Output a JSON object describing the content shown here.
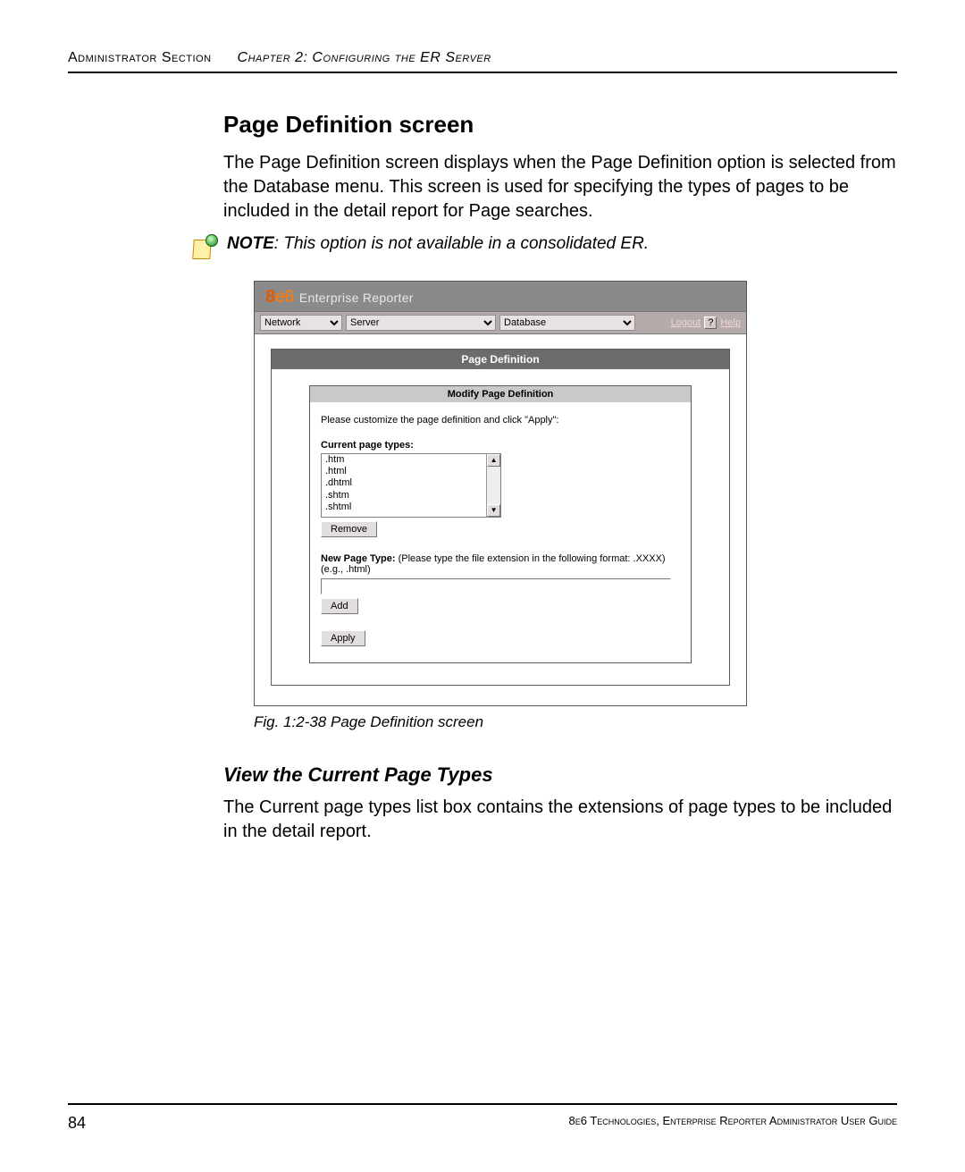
{
  "header": {
    "section": "Administrator Section",
    "chapter": "Chapter 2: Configuring the ER Server"
  },
  "section_title": "Page Definition screen",
  "intro_para": "The Page Definition screen displays when the Page Definition option is selected from the Database menu. This screen is used for specifying the types of pages to be included in the detail report for Page searches.",
  "note": {
    "label": "NOTE",
    "text": ": This option is not available in a consolidated ER."
  },
  "app": {
    "brand_8": "8",
    "brand_e6": "e6",
    "product": "Enterprise Reporter",
    "menus": {
      "network": "Network",
      "server": "Server",
      "database": "Database"
    },
    "logout": "Logout",
    "help_q": "?",
    "help": "Help",
    "panel_title": "Page Definition",
    "subpanel_title": "Modify Page Definition",
    "instruction": "Please customize the page definition and click \"Apply\":",
    "types_label": "Current page types:",
    "types": [
      ".htm",
      ".html",
      ".dhtml",
      ".shtm",
      ".shtml"
    ],
    "remove_btn": "Remove",
    "new_type_label": "New Page Type:",
    "new_type_hint": " (Please type the file extension in the following format: .XXXX) (e.g., .html)",
    "new_type_value": "",
    "add_btn": "Add",
    "apply_btn": "Apply"
  },
  "fig_caption": "Fig. 1:2-38  Page Definition screen",
  "subhead": "View the Current Page Types",
  "subhead_para": "The Current page types list box contains the extensions of page types to be included in the detail report.",
  "footer": {
    "page": "84",
    "guide": "8e6 Technologies, Enterprise Reporter Administrator User Guide"
  }
}
